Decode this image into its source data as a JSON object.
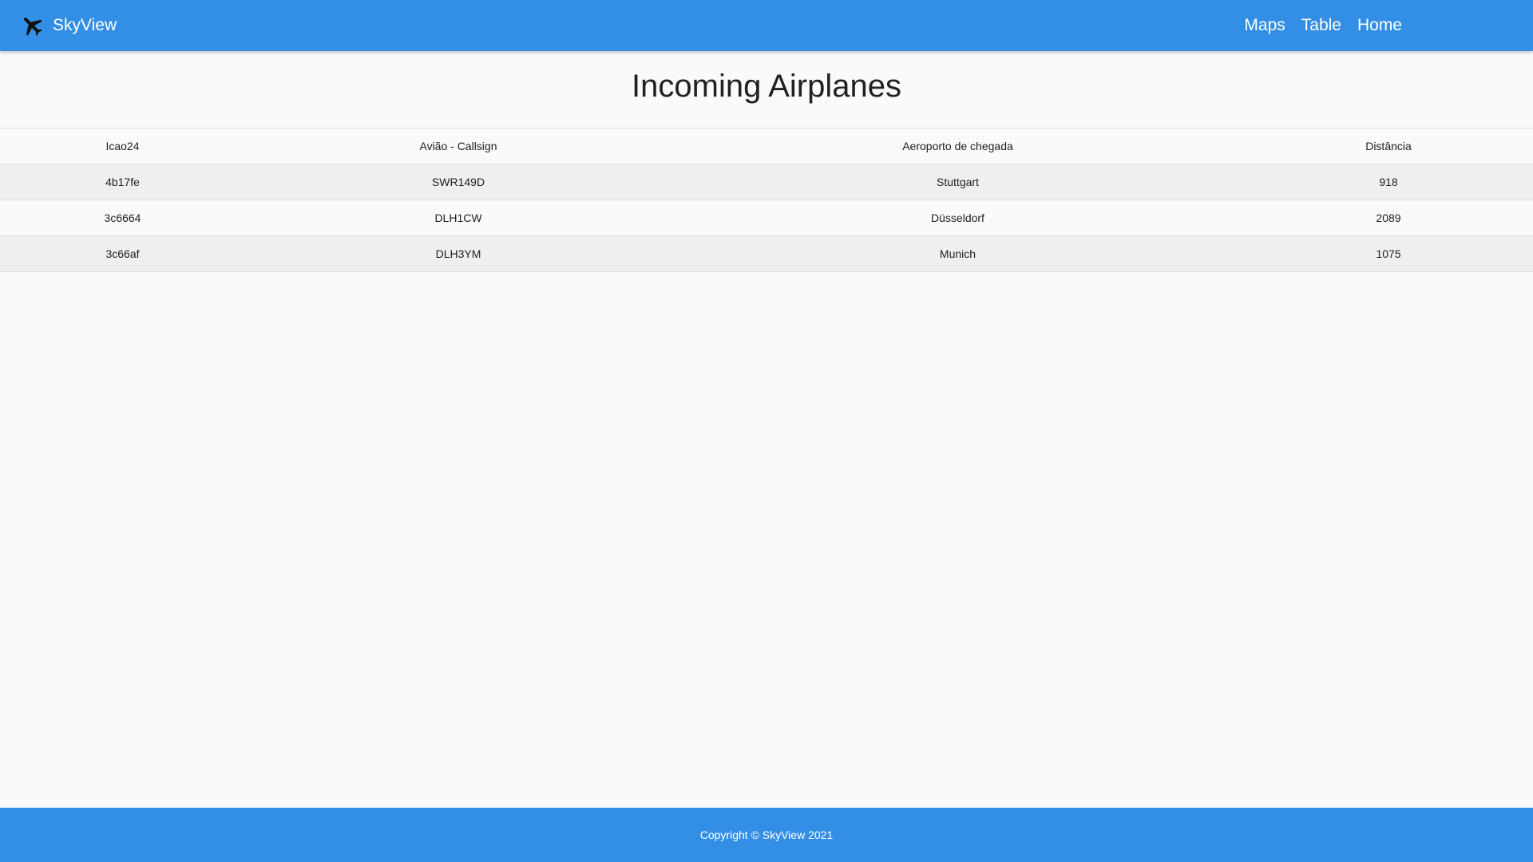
{
  "colors": {
    "primary": "#338fe6",
    "background": "#fafafa",
    "row_stripe": "#efefef"
  },
  "navbar": {
    "brand_icon": "airplane-icon",
    "brand_name": "SkyView",
    "links": [
      "Maps",
      "Table",
      "Home"
    ]
  },
  "main": {
    "title": "Incoming Airplanes",
    "table": {
      "columns": [
        "Icao24",
        "Avião - Callsign",
        "Aeroporto de chegada",
        "Distância"
      ],
      "rows": [
        [
          "4b17fe",
          "SWR149D",
          "Stuttgart",
          "918"
        ],
        [
          "3c6664",
          "DLH1CW",
          "Düsseldorf",
          "2089"
        ],
        [
          "3c66af",
          "DLH3YM",
          "Munich",
          "1075"
        ]
      ]
    }
  },
  "footer": {
    "text": "Copyright © SkyView 2021"
  }
}
